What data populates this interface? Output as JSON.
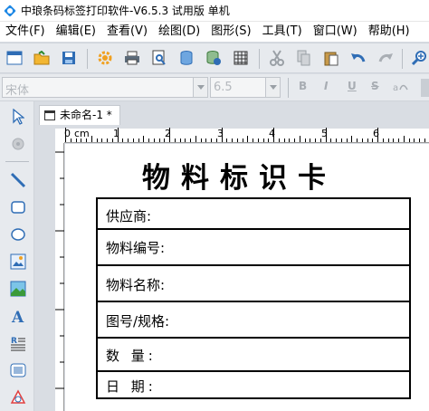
{
  "window": {
    "title": "中琅条码标签打印软件-V6.5.3 试用版 单机"
  },
  "menu": [
    "文件(F)",
    "编辑(E)",
    "查看(V)",
    "绘图(D)",
    "图形(S)",
    "工具(T)",
    "窗口(W)",
    "帮助(H)"
  ],
  "font_toolbar": {
    "font_name": "宋体",
    "font_size": "6.5",
    "bold": "B",
    "italic": "I",
    "underline": "U",
    "strike": "S"
  },
  "tab": {
    "label": "未命名-1 *"
  },
  "ruler": {
    "unit": "cm",
    "labels": [
      "0",
      "1",
      "2",
      "3",
      "4",
      "5",
      "6"
    ]
  },
  "label": {
    "title": "物料标识卡",
    "rows": [
      "供应商:",
      "物料编号:",
      "物料名称:",
      "图号/规格:",
      "数 量:",
      "日 期:"
    ]
  },
  "colors": {
    "accent": "#1e88e5",
    "toolbar_bg": "#e7eaee",
    "canvas": "#ffffff"
  }
}
